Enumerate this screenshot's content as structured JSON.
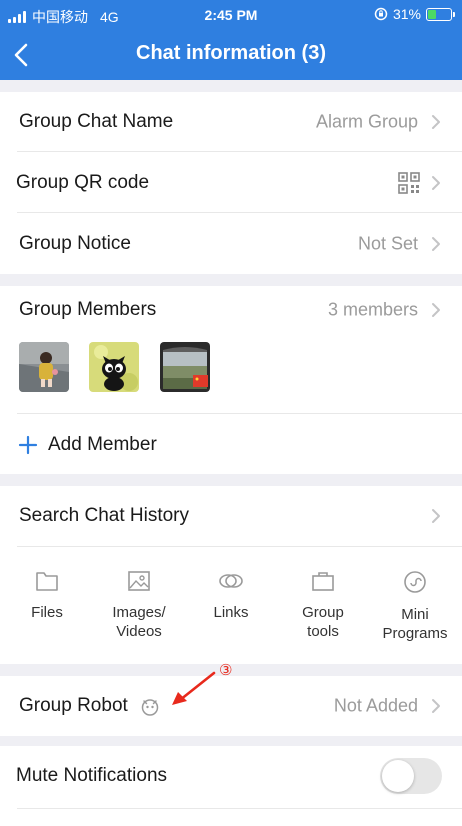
{
  "status_bar": {
    "carrier": "中国移动",
    "network": "4G",
    "time": "2:45 PM",
    "battery": "31%"
  },
  "header": {
    "title": "Chat information (3)"
  },
  "group_info": {
    "name_label": "Group Chat Name",
    "name_value": "Alarm Group",
    "qr_label": "Group QR code",
    "notice_label": "Group Notice",
    "notice_value": "Not Set"
  },
  "members": {
    "label": "Group Members",
    "count": "3 members",
    "add_label": "Add Member"
  },
  "history": {
    "search_label": "Search Chat History",
    "tools": [
      {
        "label": "Files",
        "icon": "folder-icon"
      },
      {
        "label": "Images/\nVideos",
        "icon": "image-icon"
      },
      {
        "label": "Links",
        "icon": "link-icon"
      },
      {
        "label": "Group\ntools",
        "icon": "briefcase-icon"
      },
      {
        "label": "Mini\nPrograms",
        "icon": "mini-program-icon"
      }
    ]
  },
  "robot": {
    "label": "Group Robot",
    "value": "Not Added",
    "annotation": "③"
  },
  "notifications": {
    "mute_label": "Mute Notifications",
    "mute_on": false
  },
  "colors": {
    "header": "#2f7fe0",
    "accent": "#2f7fe0",
    "annotation": "#e8291c"
  }
}
